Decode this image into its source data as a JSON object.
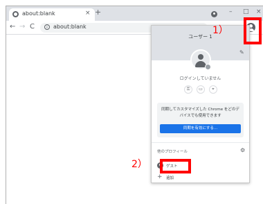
{
  "browser": {
    "tab_title": "about:blank",
    "tab_close": "×",
    "new_tab": "+",
    "window_minimize": "–",
    "window_maximize": "□",
    "window_close": "×",
    "nav_back": "←",
    "nav_forward": "→",
    "nav_reload": "C",
    "address": "about:blank",
    "info_icon": "i"
  },
  "profile_menu": {
    "user_name": "ユーザー 1",
    "status": "ログインしていません",
    "sync_message": "同期してカスタマイズした Chrome をどのデバイスでも使用できます",
    "sync_button": "同期を有効にする...",
    "other_profiles_label": "他のプロフィール",
    "guest_label": "ゲスト",
    "add_label": "追加",
    "add_symbol": "+",
    "icons": [
      "key-icon",
      "card-icon",
      "location-icon",
      "pencil-icon",
      "gear-icon",
      "guest-icon"
    ]
  },
  "annotations": {
    "label_1": "1）",
    "label_2": "2）",
    "color": "#ff0000"
  },
  "colors": {
    "accent": "#1a73e8",
    "header_bg": "#dee1e6"
  }
}
